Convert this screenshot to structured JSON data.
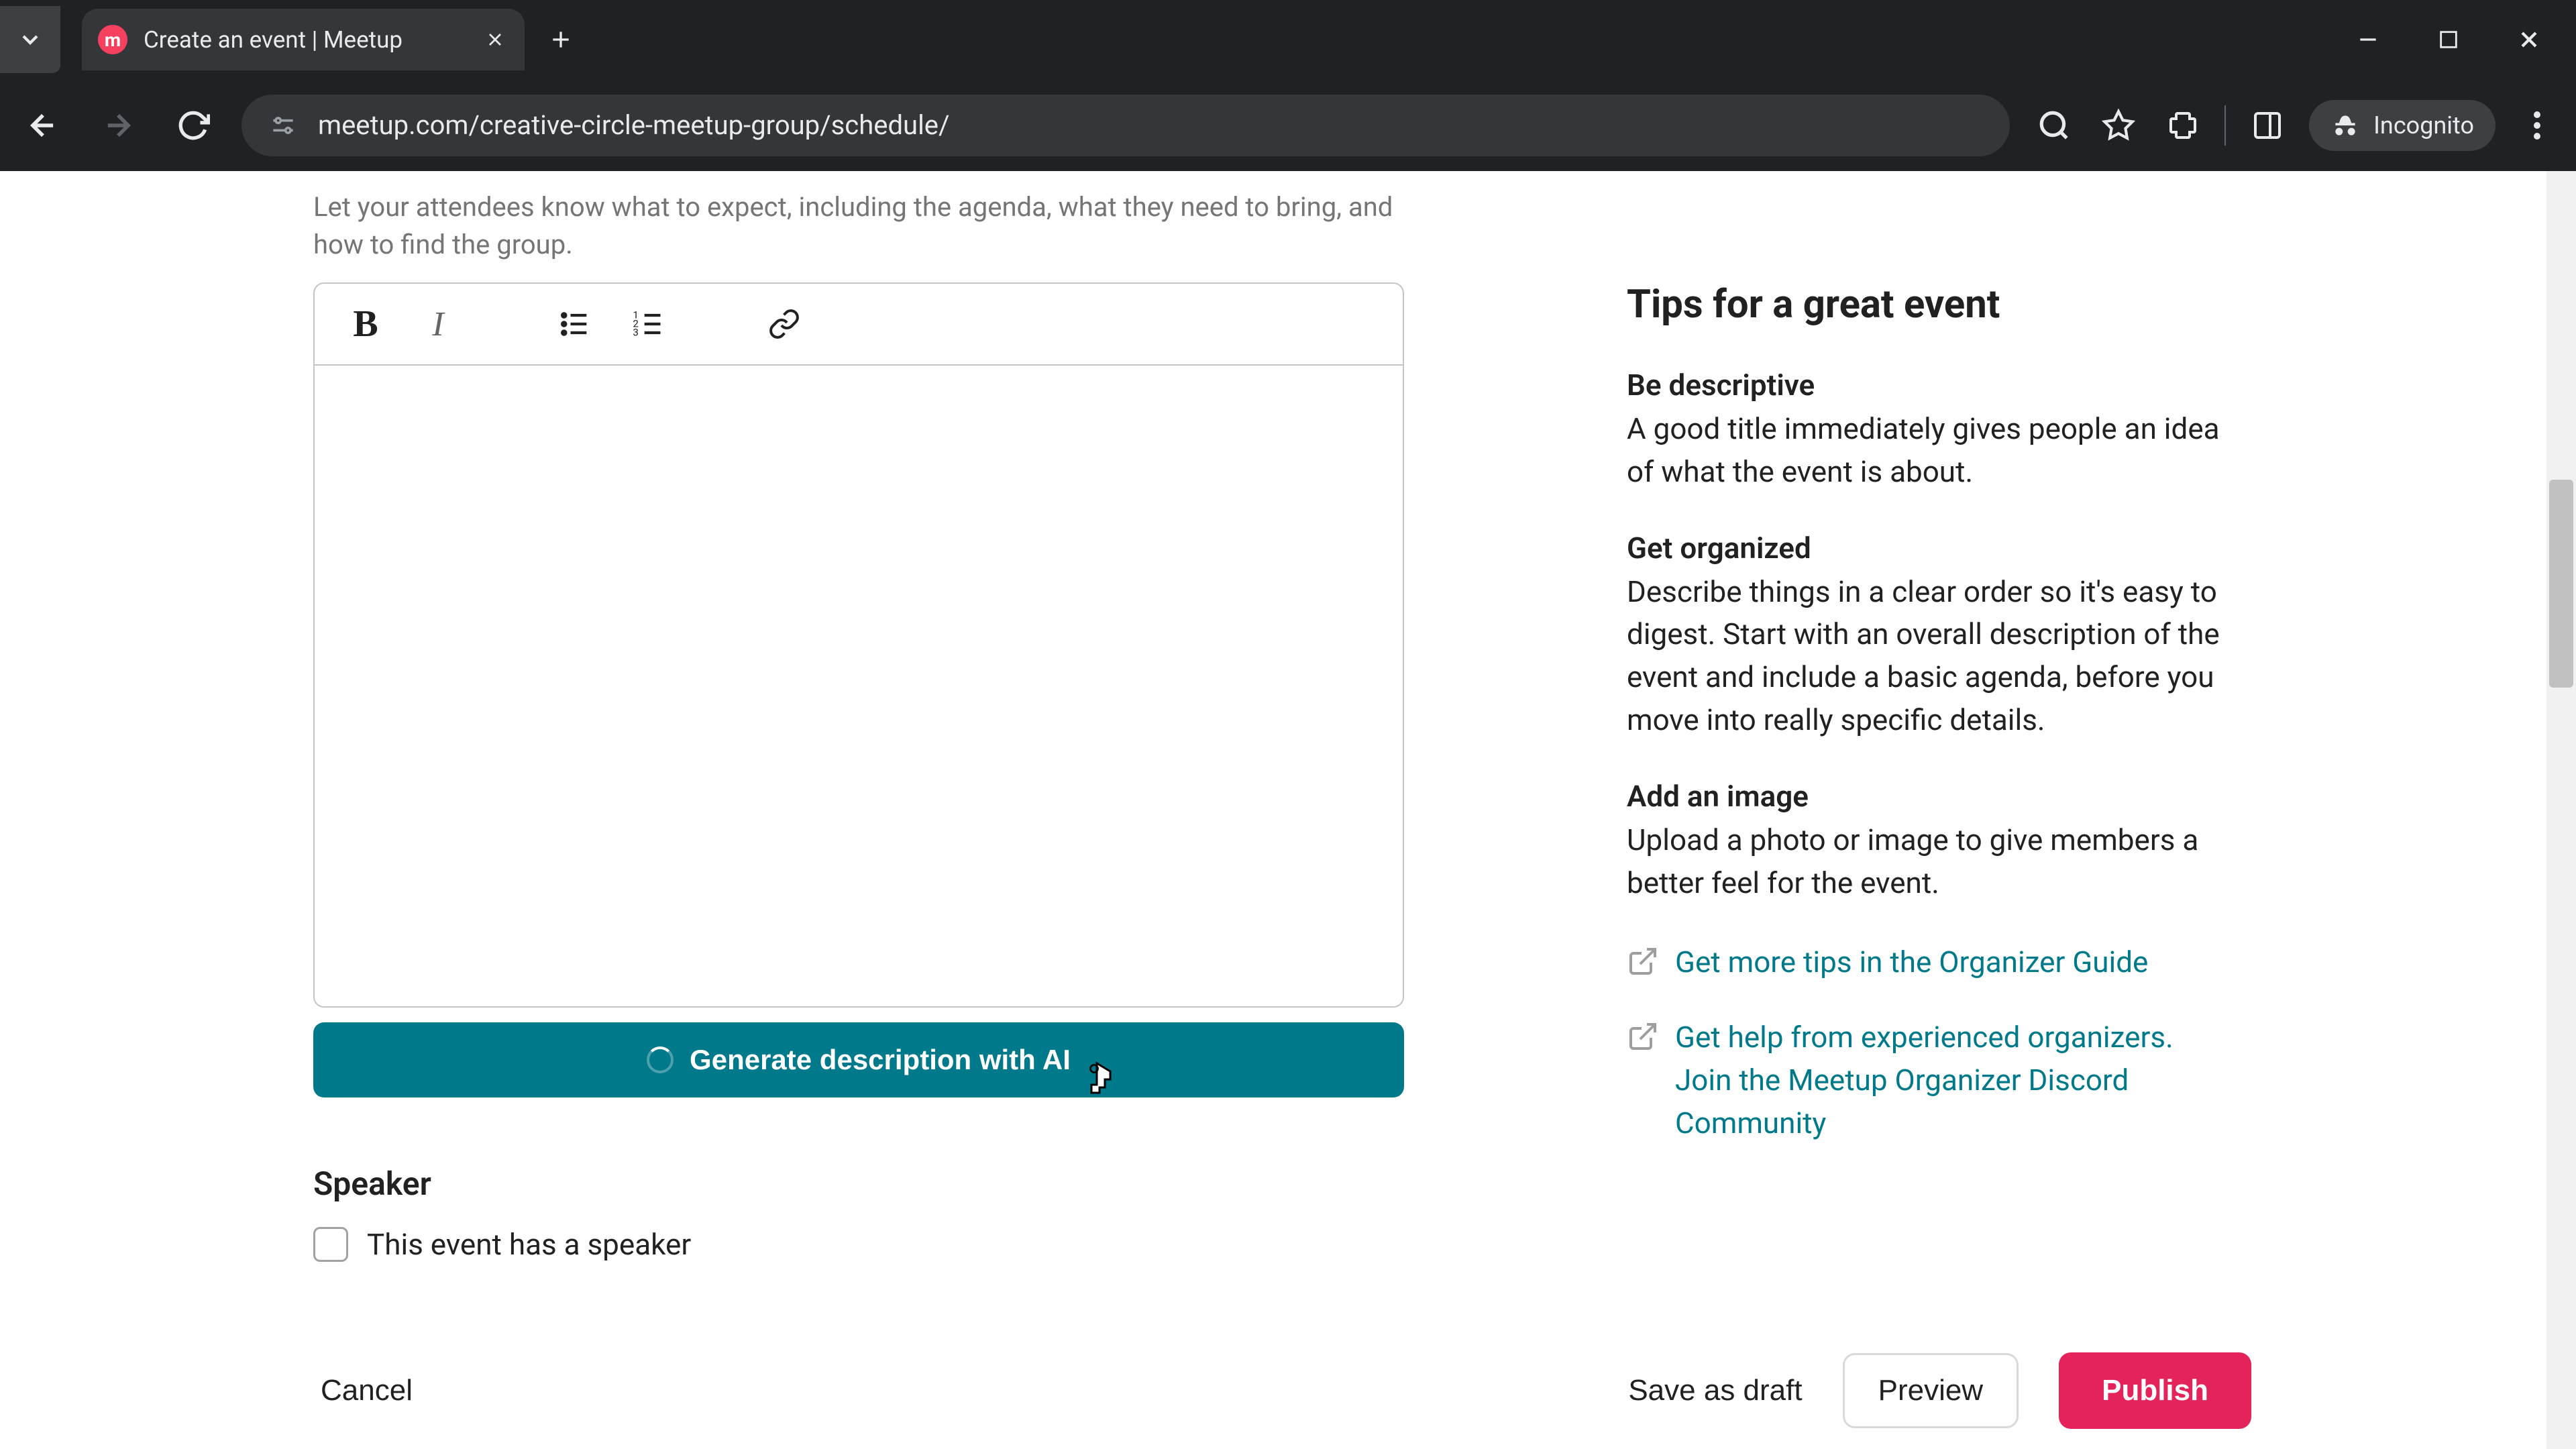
{
  "browser": {
    "tab": {
      "title": "Create an event | Meetup"
    },
    "url": "meetup.com/creative-circle-meetup-group/schedule/",
    "incognito_label": "Incognito"
  },
  "hint": "Let your attendees know what to expect, including the agenda, what they need to bring, and how to find the group.",
  "ai_button_label": "Generate description with AI",
  "speaker": {
    "heading": "Speaker",
    "checkbox_label": "This event has a speaker"
  },
  "tips": {
    "heading": "Tips for a great event",
    "items": [
      {
        "title": "Be descriptive",
        "body": "A good title immediately gives people an idea of what the event is about."
      },
      {
        "title": "Get organized",
        "body": "Describe things in a clear order so it's easy to digest. Start with an overall description of the event and include a basic agenda, before you move into really specific details."
      },
      {
        "title": "Add an image",
        "body": "Upload a photo or image to give members a better feel for the event."
      }
    ],
    "links": [
      "Get more tips in the Organizer Guide",
      "Get help from experienced organizers. Join the Meetup Organizer Discord Community"
    ]
  },
  "actions": {
    "cancel": "Cancel",
    "draft": "Save as draft",
    "preview": "Preview",
    "publish": "Publish"
  }
}
